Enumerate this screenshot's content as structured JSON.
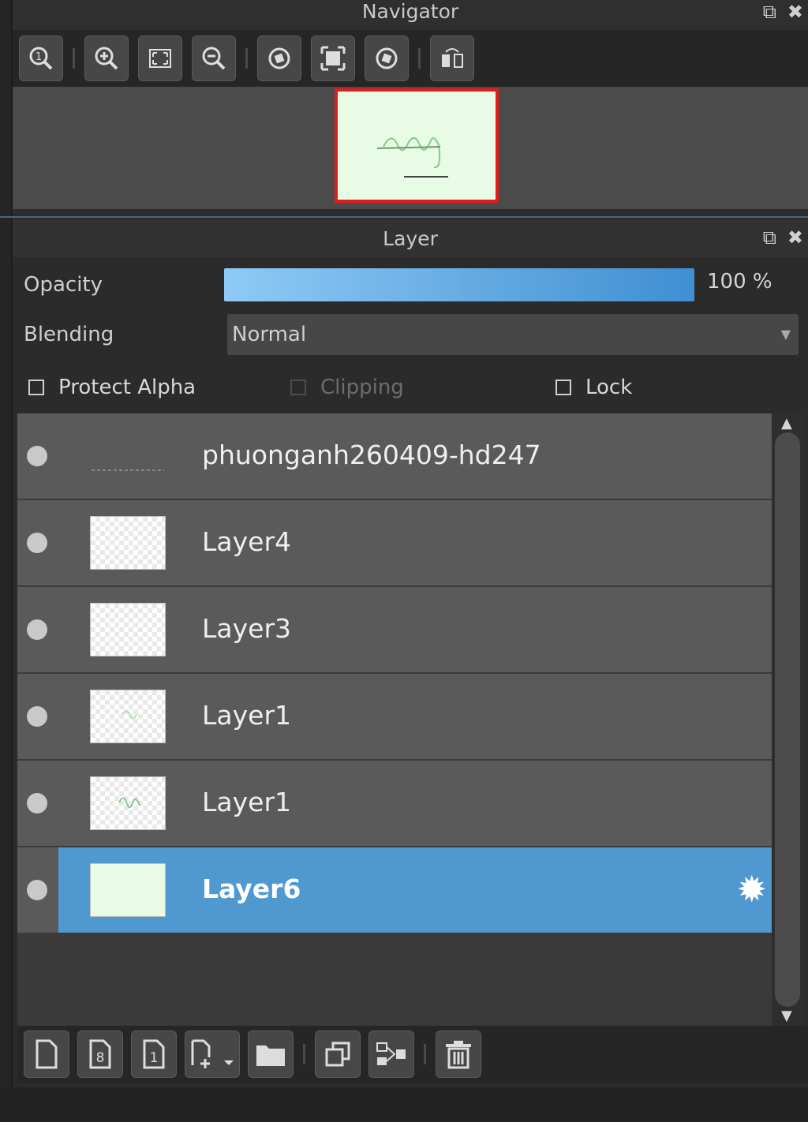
{
  "navigator": {
    "title": "Navigator",
    "toolbar_icons": [
      "zoom-actual-icon",
      "zoom-in-icon",
      "fit-icon",
      "zoom-out-icon",
      "rotate-left-icon",
      "fill-view-icon",
      "rotate-right-icon",
      "flip-icon"
    ]
  },
  "layer_panel": {
    "title": "Layer",
    "opacity_label": "Opacity",
    "opacity_value": "100 %",
    "opacity_fraction": 1.0,
    "blending_label": "Blending",
    "blending_value": "Normal",
    "protect_alpha_label": "Protect Alpha",
    "clipping_label": "Clipping",
    "lock_label": "Lock",
    "layers": [
      {
        "name": "phuonganh260409-hd247",
        "selected": false
      },
      {
        "name": "Layer4",
        "selected": false
      },
      {
        "name": "Layer3",
        "selected": false
      },
      {
        "name": "Layer1",
        "selected": false
      },
      {
        "name": "Layer1",
        "selected": false
      },
      {
        "name": "Layer6",
        "selected": true
      }
    ]
  },
  "colors": {
    "selected_row": "#4f98d0",
    "opacity_fill": "#3f8fd2",
    "nav_frame": "#e01c1c"
  }
}
